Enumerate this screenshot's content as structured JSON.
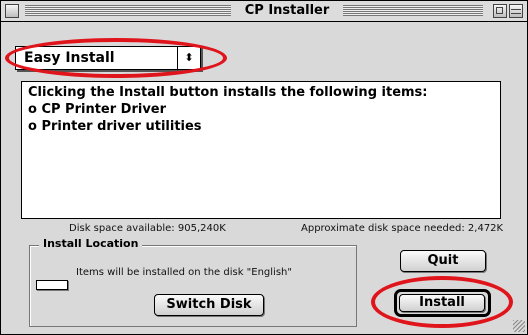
{
  "window": {
    "title": "CP Installer"
  },
  "install_type": {
    "selected": "Easy Install",
    "arrow": "⬍"
  },
  "description": {
    "lines": [
      "Clicking the Install button installs the following items:",
      "o CP Printer Driver",
      "o Printer driver utilities"
    ]
  },
  "disk_space": {
    "available": "Disk space available: 905,240K",
    "needed": "Approximate disk space needed: 2,472K"
  },
  "install_location": {
    "title": "Install Location",
    "message": "Items will be installed on the disk \"English\"",
    "switch_label": "Switch Disk"
  },
  "buttons": {
    "quit": "Quit",
    "install": "Install"
  },
  "highlight_color": "#e0141b"
}
